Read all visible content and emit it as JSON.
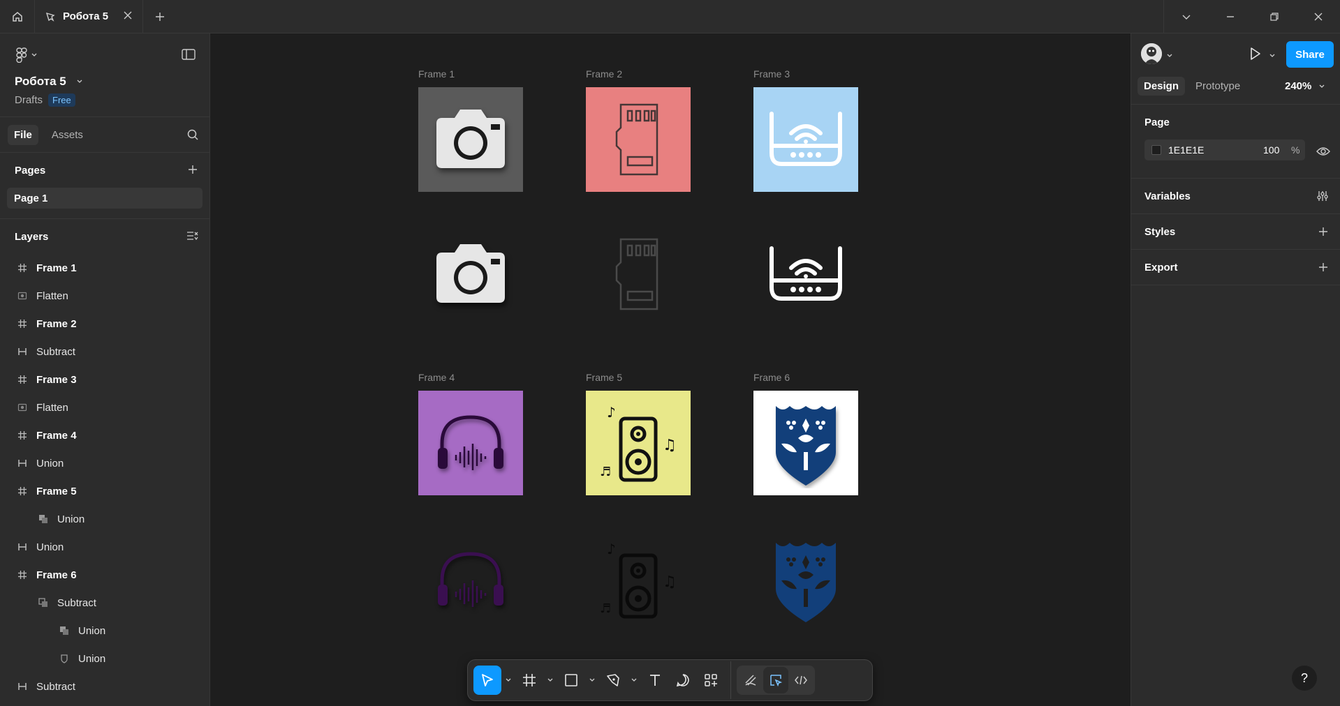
{
  "titlebar": {
    "tab_title": "Робота 5",
    "icons": [
      "home-icon",
      "file-icon",
      "close-icon",
      "plus-icon",
      "chevron-down-icon",
      "minimize-icon",
      "restore-icon",
      "close-window-icon"
    ]
  },
  "left_panel": {
    "project_name": "Робота 5",
    "location": "Drafts",
    "plan_badge": "Free",
    "tabs": [
      "File",
      "Assets"
    ],
    "pages_title": "Pages",
    "pages": [
      "Page 1"
    ],
    "layers_title": "Layers",
    "layers": [
      {
        "label": "Frame 1",
        "icon": "frame-icon",
        "indent": 0,
        "bold": true
      },
      {
        "label": "Flatten",
        "icon": "flatten-icon",
        "indent": 0,
        "bold": false
      },
      {
        "label": "Frame 2",
        "icon": "frame-icon",
        "indent": 0,
        "bold": true
      },
      {
        "label": "Subtract",
        "icon": "boolean-icon",
        "indent": 0,
        "bold": false
      },
      {
        "label": "Frame 3",
        "icon": "frame-icon",
        "indent": 0,
        "bold": true
      },
      {
        "label": "Flatten",
        "icon": "flatten-icon",
        "indent": 0,
        "bold": false
      },
      {
        "label": "Frame 4",
        "icon": "frame-icon",
        "indent": 0,
        "bold": true
      },
      {
        "label": "Union",
        "icon": "boolean-icon",
        "indent": 0,
        "bold": false
      },
      {
        "label": "Frame 5",
        "icon": "frame-icon",
        "indent": 0,
        "bold": true
      },
      {
        "label": "Union",
        "icon": "union-icon",
        "indent": 1,
        "bold": false
      },
      {
        "label": "Union",
        "icon": "boolean-icon",
        "indent": 0,
        "bold": false
      },
      {
        "label": "Frame 6",
        "icon": "frame-icon",
        "indent": 0,
        "bold": true
      },
      {
        "label": "Subtract",
        "icon": "subtract-icon",
        "indent": 1,
        "bold": false
      },
      {
        "label": "Union",
        "icon": "union-icon",
        "indent": 2,
        "bold": false
      },
      {
        "label": "Union",
        "icon": "shield-icon",
        "indent": 2,
        "bold": false
      },
      {
        "label": "Subtract",
        "icon": "boolean-icon",
        "indent": 0,
        "bold": false
      }
    ]
  },
  "canvas": {
    "frames": [
      {
        "label": "Frame 1",
        "bg": "#5a5a5a",
        "icon": "camera-icon"
      },
      {
        "label": "Frame 2",
        "bg": "#e88080",
        "icon": "sd-card-icon"
      },
      {
        "label": "Frame 3",
        "bg": "#a8d4f4",
        "icon": "router-icon"
      },
      {
        "label": "Frame 4",
        "bg": "#a66bc4",
        "icon": "headphones-icon"
      },
      {
        "label": "Frame 5",
        "bg": "#e8e88a",
        "icon": "speaker-icon"
      },
      {
        "label": "Frame 6",
        "bg": "#ffffff",
        "icon": "ornament-shield-icon"
      }
    ]
  },
  "toolbar": {
    "tools": [
      "move-tool",
      "frame-tool",
      "shape-tool",
      "pen-tool",
      "text-tool",
      "comment-tool",
      "actions-tool",
      "draw-mode",
      "design-mode",
      "dev-mode"
    ]
  },
  "right_panel": {
    "share_label": "Share",
    "tabs": [
      "Design",
      "Prototype"
    ],
    "zoom": "240%",
    "page_title": "Page",
    "page_fill_hex": "1E1E1E",
    "page_fill_opacity": "100",
    "percent_sign": "%",
    "variables_title": "Variables",
    "styles_title": "Styles",
    "export_title": "Export",
    "help_label": "?"
  },
  "colors": {
    "accent": "#0d99ff",
    "panel": "#2c2c2c",
    "canvas": "#1e1e1e"
  }
}
